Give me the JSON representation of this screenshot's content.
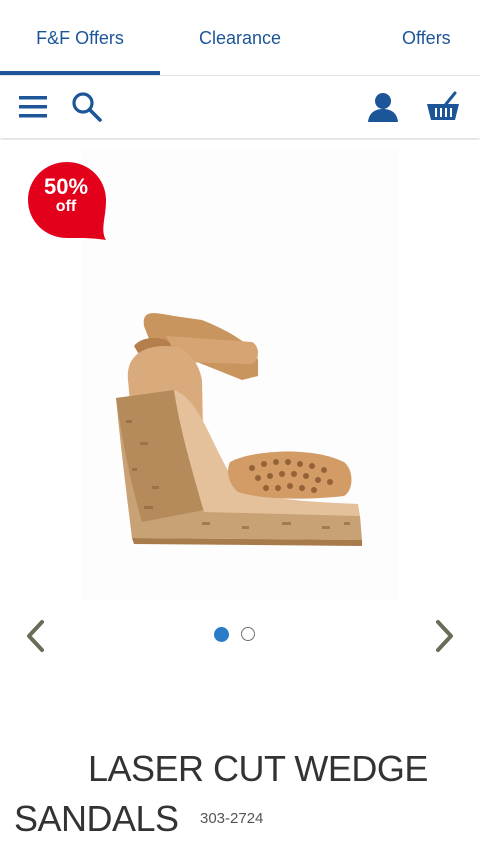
{
  "tabs": [
    {
      "label": "F&F Offers",
      "active": true
    },
    {
      "label": "Clearance",
      "active": false
    },
    {
      "label": "Offers",
      "active": false
    }
  ],
  "toolbar": {
    "icons": [
      "menu-icon",
      "search-icon",
      "account-icon",
      "basket-icon"
    ]
  },
  "product": {
    "badge": {
      "percent": "50%",
      "suffix": "off",
      "color": "#e2001a"
    },
    "title_line1": "LASER CUT WEDGE",
    "title_line2": "SANDALS",
    "sku": "303-2724",
    "gallery": {
      "total": 2,
      "current": 1
    }
  },
  "colors": {
    "brand_blue": "#1d5599",
    "dot_active": "#2a7cc9",
    "arrow": "#6b6b57"
  }
}
